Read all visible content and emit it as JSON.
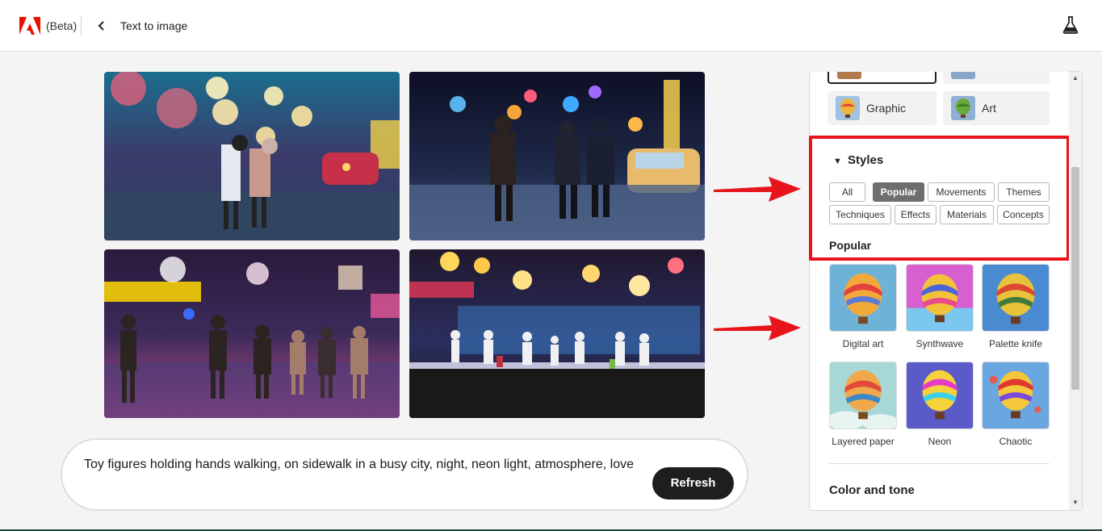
{
  "header": {
    "beta_label": "(Beta)",
    "page_title": "Text to image",
    "icons": {
      "logo": "adobe-logo",
      "back": "chevron-left-icon",
      "labs": "flask-icon"
    }
  },
  "images": [
    {
      "name": "generated-image-1"
    },
    {
      "name": "generated-image-2"
    },
    {
      "name": "generated-image-3"
    },
    {
      "name": "generated-image-4"
    }
  ],
  "prompt": {
    "text": "Toy figures holding hands walking, on sidewalk in a busy city, night, neon light, atmosphere, love",
    "refresh_label": "Refresh"
  },
  "panel": {
    "content_types": [
      {
        "label": "Graphic"
      },
      {
        "label": "Art"
      }
    ],
    "styles": {
      "heading": "Styles",
      "chips": [
        "All",
        "Popular",
        "Movements",
        "Themes",
        "Techniques",
        "Effects",
        "Materials",
        "Concepts"
      ],
      "active_chip": "Popular",
      "section_label": "Popular",
      "items": [
        "Digital art",
        "Synthwave",
        "Palette knife",
        "Layered paper",
        "Neon",
        "Chaotic"
      ]
    },
    "color_tone_heading": "Color and tone"
  },
  "colors": {
    "highlight_red": "#e8141b",
    "adobe_red": "#eb1000",
    "button_dark": "#1e1e1e",
    "chip_active": "#6e6e6e"
  }
}
